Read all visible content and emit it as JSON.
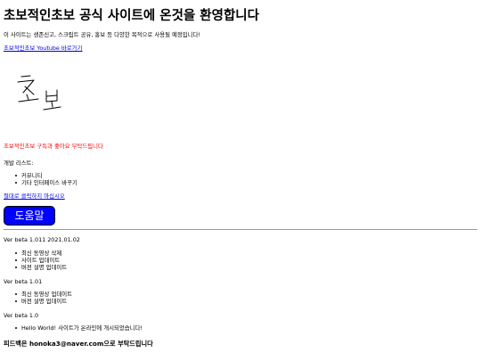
{
  "page": {
    "title": "초보적인초보 공식 사이트에 온것을 환영합니다",
    "intro": "이 사이트는 생존신고, 스크립트 공유, 홍보 등 다양한 목적으로 사용될 예정입니다!",
    "youtube_link": "초보적인초보 Youtube 바로가기",
    "logo_text": "초보",
    "subscribe_notice": "초보적인초보 구독과 좋아요 부탁드립니다",
    "dev_list_label": "개발 리스트:",
    "dev_list": [
      "커뮤니티",
      "기타 인터페이스 바꾸기"
    ],
    "dont_click_link": "절대로 클릭하지 마십시오",
    "help_button": "도움말"
  },
  "changelog": [
    {
      "version": "Ver beta 1.011 2021.01.02",
      "items": [
        "최신 동영상 삭제",
        "사이트 업데이트",
        "버전 설명 업데이트"
      ]
    },
    {
      "version": "Ver beta 1.01",
      "items": [
        "최신 동영상 업데이트",
        "버전 설명 업데이트"
      ]
    },
    {
      "version": "Ver beta 1.0",
      "items": [
        "Hello World! 사이트가 온라인에 개시되었습니다!"
      ]
    }
  ],
  "footer": {
    "prefix": "피드백은 ",
    "email": "honoka3@naver.com",
    "suffix": "으로 부탁드립니다"
  },
  "colors": {
    "link": "#0000ee",
    "notice": "#ff0000",
    "button_bg": "#0000ff",
    "button_text": "#ffffff"
  }
}
